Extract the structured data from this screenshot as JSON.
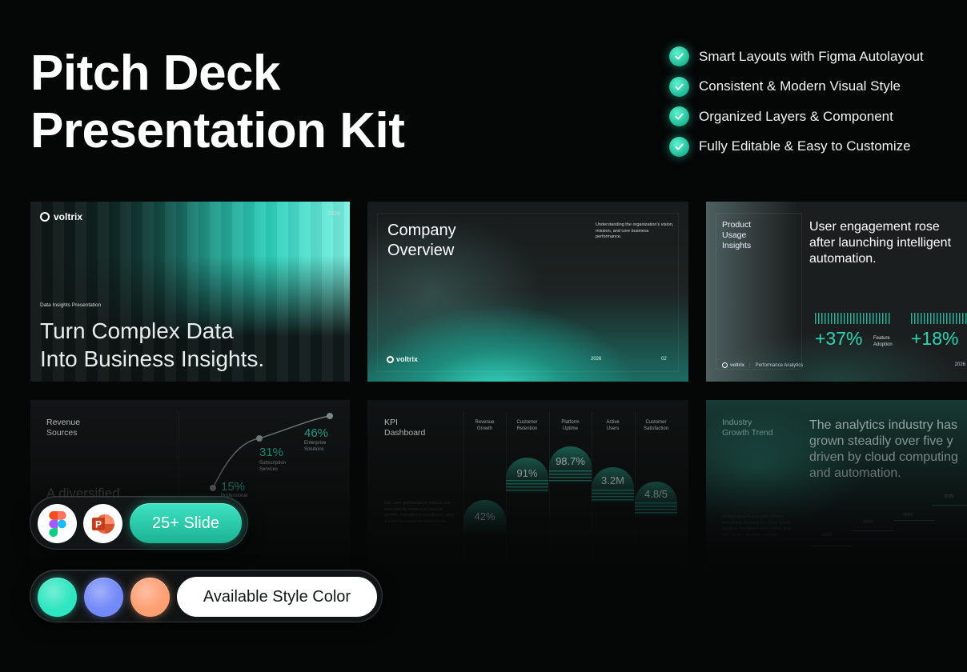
{
  "hero": {
    "title_line1": "Pitch Deck",
    "title_line2": "Presentation Kit"
  },
  "features": [
    {
      "label": "Smart Layouts with Figma Autolayout"
    },
    {
      "label": "Consistent & Modern Visual Style"
    },
    {
      "label": "Organized Layers & Component"
    },
    {
      "label": "Fully Editable & Easy to Customize"
    }
  ],
  "slides": {
    "cover": {
      "brand": "voltrix",
      "year": "2026",
      "eyebrow": "Data Insights Presentation",
      "headline_line1": "Turn Complex Data",
      "headline_line2": "Into Business Insights."
    },
    "overview": {
      "title_line1": "Company",
      "title_line2": "Overview",
      "description": "Understanding the organization's vision, mission, and core business performance.",
      "brand": "voltrix",
      "year": "2026",
      "page": "02"
    },
    "usage": {
      "label_line1": "Product",
      "label_line2": "Usage",
      "label_line3": "Insights",
      "headline_line1": "User engagement rose",
      "headline_line2": "after launching intelligent",
      "headline_line3": "automation.",
      "stat1": "+37%",
      "stat1_label_line1": "Feature",
      "stat1_label_line2": "Adoption",
      "stat2": "+18%",
      "footer_brand": "voltrix",
      "footer_text": "Performance Analytics",
      "year": "2026"
    },
    "revenue": {
      "title_line1": "Revenue",
      "title_line2": "Sources",
      "values": [
        {
          "value": "15%",
          "label_line1": "Professional",
          "label_line2": ""
        },
        {
          "value": "31%",
          "label_line1": "Subscription",
          "label_line2": "Services"
        },
        {
          "value": "46%",
          "label_line1": "Enterprise",
          "label_line2": "Solutions"
        }
      ],
      "body": "A diversified"
    },
    "kpi": {
      "title_line1": "KPI",
      "title_line2": "Dashboard",
      "columns": [
        {
          "h1": "Revenue",
          "h2": "Growth",
          "value": "42%"
        },
        {
          "h1": "Customer",
          "h2": "Retention",
          "value": "91%"
        },
        {
          "h1": "Platform",
          "h2": "Uptime",
          "value": "98.7%"
        },
        {
          "h1": "Active",
          "h2": "Users",
          "value": "3.2M"
        },
        {
          "h1": "Customer",
          "h2": "Satisfaction",
          "value": "4.8/5"
        }
      ],
      "body": "Our core performance metrics are consistently tracked to ensure growth, operational excellence, and a superior customer experience."
    },
    "industry": {
      "title_line1": "Industry",
      "title_line2": "Growth Trend",
      "headline_line1": "The analytics industry has",
      "headline_line2": "grown steadily over five y",
      "headline_line3": "driven by cloud computing",
      "headline_line4": "and automation.",
      "years": [
        "2022",
        "2023",
        "2024",
        "2025"
      ],
      "body": "Market analytics growth reflects increasing demand for cloud based insights, intelligent automation, and data driven decision making."
    }
  },
  "tools": {
    "figma": "figma-icon",
    "powerpoint": "powerpoint-icon",
    "badge": "25+ Slide"
  },
  "style_colors": {
    "swatches": [
      "#2ee6c0",
      "#7289f8",
      "#fd9f73"
    ],
    "label": "Available Style Color"
  },
  "accent": "#2fd6b4"
}
